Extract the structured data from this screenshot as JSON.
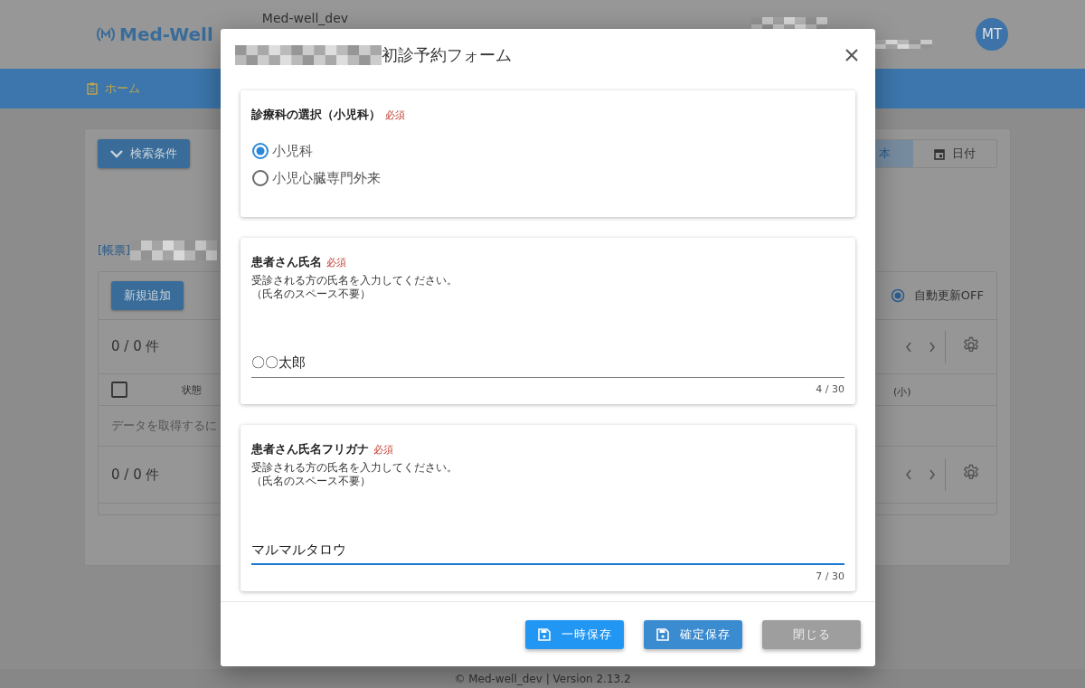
{
  "header": {
    "logo": "Med-Well",
    "env": "Med-well_dev",
    "avatar": "MT"
  },
  "nav": {
    "items": [
      {
        "label": "ホーム",
        "selected": true
      }
    ]
  },
  "search_panel": {
    "toggle_button": "検索条件",
    "view_tabs": [
      {
        "label": "本",
        "selected": true
      },
      {
        "label": "日付",
        "selected": false
      }
    ]
  },
  "list": {
    "title_prefix": "[帳票]",
    "add_button": "新規追加",
    "auto_refresh": {
      "label": "自動更新OFF",
      "selected": true
    },
    "count_top": "0 / 0 件",
    "select_all_checked": false,
    "columns": [
      "状態",
      "(小)"
    ],
    "empty_message": "データを取得するに",
    "count_bottom": "0 / 0 件"
  },
  "footer": "© Med-well_dev | Version 2.13.2",
  "dialog": {
    "title": "初診予約フォーム",
    "sections": [
      {
        "kind": "radio",
        "label": "診療科の選択（小児科）",
        "required": "必須",
        "options": [
          {
            "label": "小児科",
            "selected": true
          },
          {
            "label": "小児心臓専門外来",
            "selected": false
          }
        ]
      },
      {
        "kind": "text",
        "label": "患者さん氏名",
        "required": "必須",
        "help": [
          "受診される方の氏名を入力してください。",
          "（氏名のスペース不要）"
        ],
        "value": "〇〇太郎",
        "counter": "4 / 30",
        "focused": false
      },
      {
        "kind": "text",
        "label": "患者さん氏名フリガナ",
        "required": "必須",
        "help": [
          "受診される方の氏名を入力してください。",
          "（氏名のスペース不要）"
        ],
        "value": "マルマルタロウ",
        "counter": "7 / 30",
        "focused": true
      }
    ],
    "buttons": [
      {
        "label": "一時保存",
        "kind": "temp"
      },
      {
        "label": "確定保存",
        "kind": "confirm"
      },
      {
        "label": "閉じる",
        "kind": "close"
      }
    ]
  }
}
